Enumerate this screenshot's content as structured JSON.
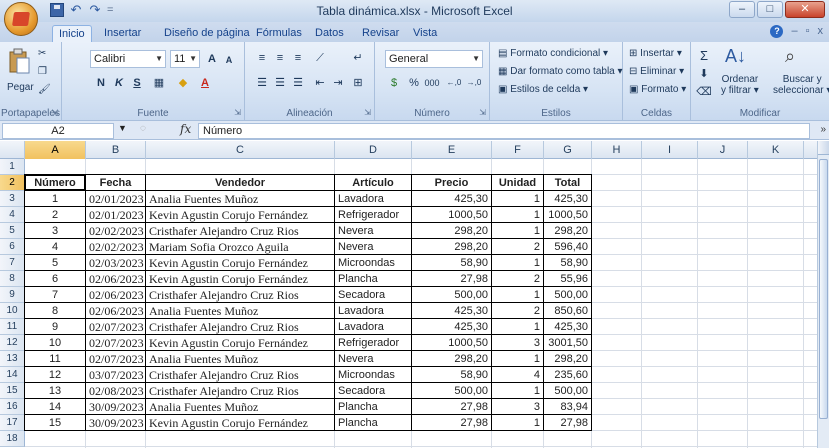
{
  "window": {
    "title": "Tabla dinámica.xlsx - Microsoft Excel",
    "controls": {
      "minimize": "–",
      "maximize": "□",
      "close": "✕"
    }
  },
  "quick_access": {
    "undo": "↶",
    "redo": "↷",
    "customize": "="
  },
  "tabs": [
    {
      "label": "Inicio",
      "active": true
    },
    {
      "label": "Insertar"
    },
    {
      "label": "Diseño de página"
    },
    {
      "label": "Fórmulas"
    },
    {
      "label": "Datos"
    },
    {
      "label": "Revisar"
    },
    {
      "label": "Vista"
    }
  ],
  "tabbar_right": {
    "help": "?",
    "min": "–",
    "restore": "▫",
    "close": "x"
  },
  "ribbon": {
    "portapapeles": {
      "label": "Portapapeles",
      "pegar": "Pegar"
    },
    "fuente": {
      "label": "Fuente",
      "font_name": "Calibri",
      "font_size": "11",
      "grow": "A",
      "shrink": "A",
      "bold": "N",
      "italic": "K",
      "underline": "S"
    },
    "alineacion": {
      "label": "Alineación"
    },
    "numero": {
      "label": "Número",
      "format": "General",
      "percent": "%",
      "thousands": "000",
      "inc_dec": ",0 ,00",
      "dec_dec": ",00 ,0"
    },
    "estilos": {
      "label": "Estilos",
      "conditional": "Formato condicional",
      "as_table": "Dar formato como tabla",
      "cell_styles": "Estilos de celda"
    },
    "celdas": {
      "label": "Celdas",
      "insert": "Insertar",
      "delete": "Eliminar",
      "format": "Formato"
    },
    "modificar": {
      "label": "Modificar",
      "sort_1": "Ordenar",
      "sort_2": "y filtrar",
      "find_1": "Buscar y",
      "find_2": "seleccionar"
    }
  },
  "formula_bar": {
    "name_box": "A2",
    "fx": "fx",
    "content": "Número"
  },
  "columns": [
    "A",
    "B",
    "C",
    "D",
    "E",
    "F",
    "G",
    "H",
    "I",
    "J",
    "K",
    "L"
  ],
  "selected": {
    "column": "A",
    "row": "2"
  },
  "rows": [
    "1",
    "2",
    "3",
    "4",
    "5",
    "6",
    "7",
    "8",
    "9",
    "10",
    "11",
    "12",
    "13",
    "14",
    "15",
    "16",
    "17",
    "18"
  ],
  "table": {
    "headers": [
      "Número",
      "Fecha",
      "Vendedor",
      "Artículo",
      "Precio",
      "Unidad",
      "Total"
    ],
    "data": [
      [
        "1",
        "02/01/2023",
        "Analia Fuentes Muñoz",
        "Lavadora",
        "425,30",
        "1",
        "425,30"
      ],
      [
        "2",
        "02/01/2023",
        "Kevin Agustin Corujo Fernández",
        "Refrigerador",
        "1000,50",
        "1",
        "1000,50"
      ],
      [
        "3",
        "02/02/2023",
        "Cristhafer Alejandro Cruz Rios",
        "Nevera",
        "298,20",
        "1",
        "298,20"
      ],
      [
        "4",
        "02/02/2023",
        "Mariam Sofia Orozco Aguila",
        "Nevera",
        "298,20",
        "2",
        "596,40"
      ],
      [
        "5",
        "02/03/2023",
        "Kevin Agustin Corujo Fernández",
        "Microondas",
        "58,90",
        "1",
        "58,90"
      ],
      [
        "6",
        "02/06/2023",
        "Kevin Agustin Corujo Fernández",
        "Plancha",
        "27,98",
        "2",
        "55,96"
      ],
      [
        "7",
        "02/06/2023",
        "Cristhafer Alejandro Cruz Rios",
        "Secadora",
        "500,00",
        "1",
        "500,00"
      ],
      [
        "8",
        "02/06/2023",
        "Analia Fuentes Muñoz",
        "Lavadora",
        "425,30",
        "2",
        "850,60"
      ],
      [
        "9",
        "02/07/2023",
        "Cristhafer Alejandro Cruz Rios",
        "Lavadora",
        "425,30",
        "1",
        "425,30"
      ],
      [
        "10",
        "02/07/2023",
        "Kevin Agustin Corujo Fernández",
        "Refrigerador",
        "1000,50",
        "3",
        "3001,50"
      ],
      [
        "11",
        "02/07/2023",
        "Analia Fuentes Muñoz",
        "Nevera",
        "298,20",
        "1",
        "298,20"
      ],
      [
        "12",
        "03/07/2023",
        "Cristhafer Alejandro Cruz Rios",
        "Microondas",
        "58,90",
        "4",
        "235,60"
      ],
      [
        "13",
        "02/08/2023",
        "Cristhafer Alejandro Cruz Rios",
        "Secadora",
        "500,00",
        "1",
        "500,00"
      ],
      [
        "14",
        "30/09/2023",
        "Analia Fuentes Muñoz",
        "Plancha",
        "27,98",
        "3",
        "83,94"
      ],
      [
        "15",
        "30/09/2023",
        "Kevin Agustin Corujo Fernández",
        "Plancha",
        "27,98",
        "1",
        "27,98"
      ]
    ]
  },
  "colors": {
    "accent": "#15428b",
    "selection": "#f1c15f",
    "ribbon": "#d7e4f4"
  }
}
